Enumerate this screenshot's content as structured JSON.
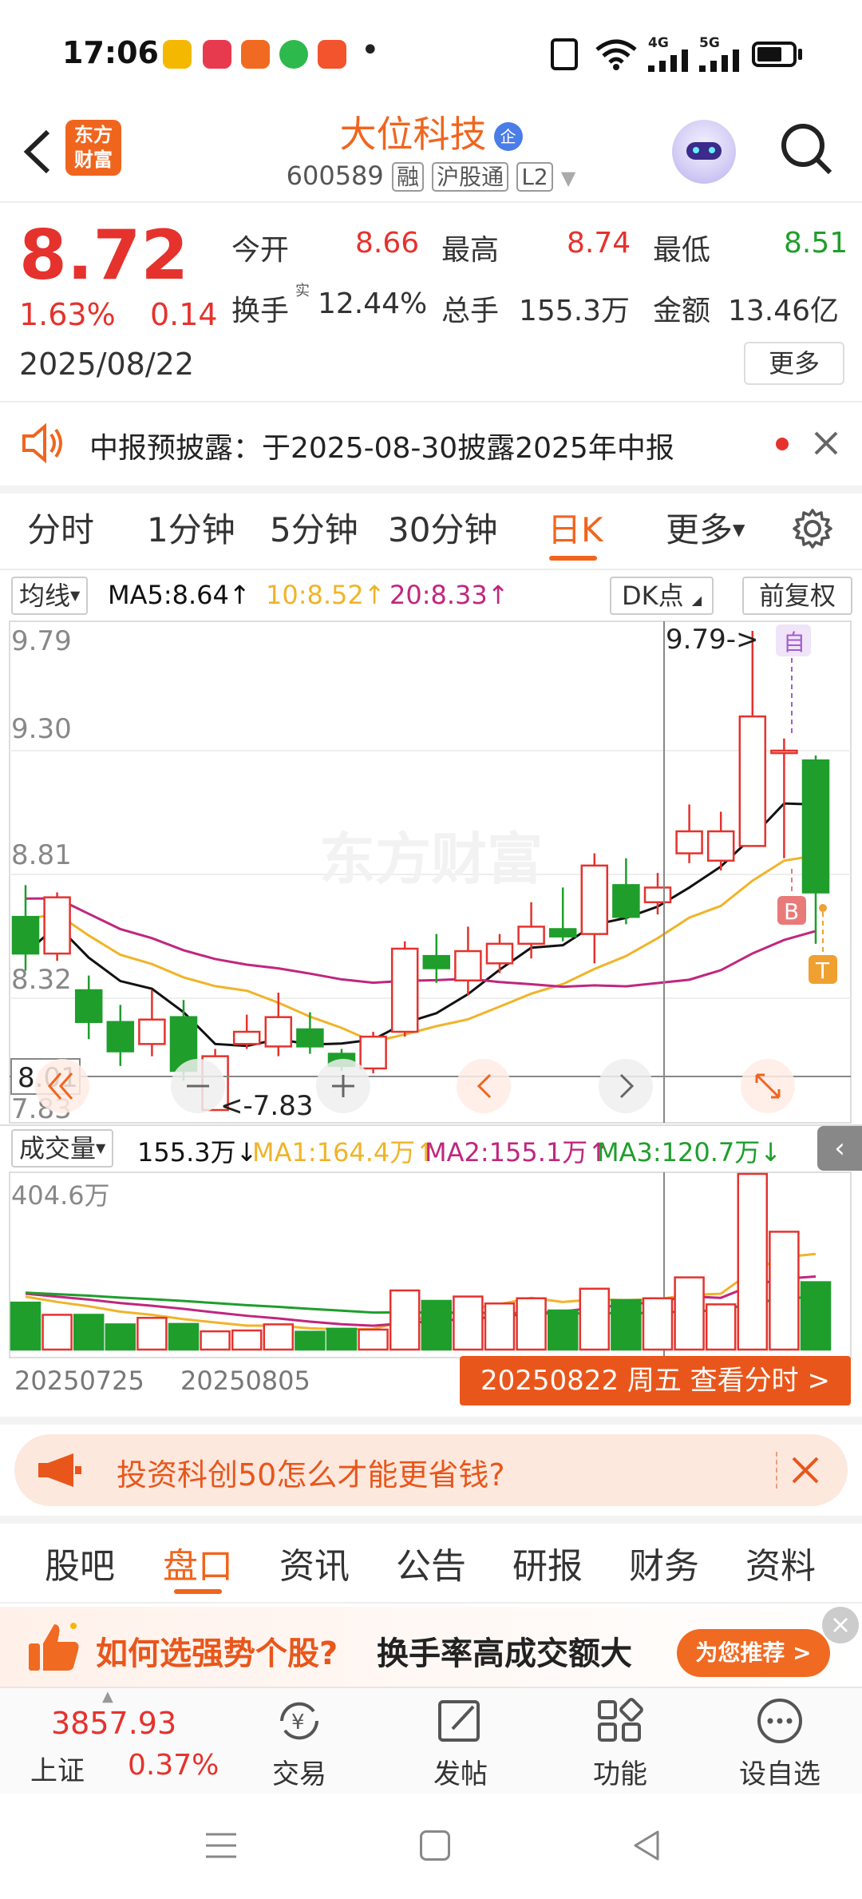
{
  "status_bar": {
    "time": "17:06",
    "app_icons": [
      "app1",
      "xiaohongshu",
      "app3",
      "app4",
      "app5"
    ],
    "notif_dot": "•",
    "signal_4g": "4G",
    "signal_5g": "5G"
  },
  "header": {
    "title": "大位科技",
    "title_badge": "企",
    "code": "600589",
    "tag_rong": "融",
    "tag_hgt": "沪股通",
    "tag_l2": "L2",
    "logo_text_1": "东方",
    "logo_text_2": "财富"
  },
  "quote": {
    "price": "8.72",
    "change_pct": "1.63%",
    "change": "0.14",
    "date": "2025/08/22",
    "open_label": "今开",
    "open": "8.66",
    "high_label": "最高",
    "high": "8.74",
    "low_label": "最低",
    "low": "8.51",
    "turnover_label": "换手",
    "turnover_sup": "实",
    "turnover": "12.44%",
    "volume_label": "总手",
    "volume": "155.3万",
    "amount_label": "金额",
    "amount": "13.46亿",
    "more_label": "更多"
  },
  "notice": {
    "text": "中报预披露：于2025-08-30披露2025年中报"
  },
  "chart_tabs": {
    "items": [
      "分时",
      "1分钟",
      "5分钟",
      "30分钟",
      "日K",
      "更多"
    ],
    "active": "日K"
  },
  "ma_bar": {
    "dropdown": "均线",
    "ma5": "MA5:8.64↑",
    "ma10": "10:8.52↑",
    "ma20": "20:8.33↑",
    "dk_label": "DK点",
    "adjust_label": "前复权"
  },
  "kchart": {
    "y_labels": [
      "9.79",
      "9.30",
      "8.81",
      "8.32",
      "7.83"
    ],
    "crosshair_price": "8.01",
    "high_marker": "9.79->",
    "low_marker": "<-7.83",
    "watermark": "东方财富",
    "marker_zi": "自",
    "marker_b": "B",
    "marker_t": "T"
  },
  "volume_bar": {
    "dropdown": "成交量",
    "vol": "155.3万↓",
    "ma1": "MA1:164.4万↑",
    "ma2": "MA2:155.1万↑",
    "ma3": "MA3:120.7万↓",
    "max_label": "404.6万"
  },
  "x_axis": {
    "d1": "20250725",
    "d2": "20250805",
    "view_time_label": "20250822 周五 查看分时 >"
  },
  "ad_banner": {
    "text": "投资科创50怎么才能更省钱?"
  },
  "bottom_tabs": {
    "items": [
      "股吧",
      "盘口",
      "资讯",
      "公告",
      "研报",
      "财务",
      "资料"
    ],
    "active": "盘口"
  },
  "promo": {
    "text1": "如何选强势个股?",
    "text2": "换手率高成交额大",
    "button": "为您推荐 >"
  },
  "bottom_nav": {
    "index_value": "3857.93",
    "index_name": "上证",
    "index_change": "0.37%",
    "trade": "交易",
    "post": "发帖",
    "func": "功能",
    "watch": "设自选"
  },
  "colors": {
    "up": "#e5322d",
    "down": "#1f9e2c",
    "accent": "#f0651e",
    "ma5": "#111111",
    "ma10": "#f0b429",
    "ma20": "#c0267e"
  },
  "chart_data": {
    "type": "candlestick",
    "ylim": [
      7.83,
      9.79
    ],
    "candles": [
      {
        "o": 8.62,
        "c": 8.47,
        "h": 8.75,
        "l": 8.4
      },
      {
        "o": 8.47,
        "c": 8.7,
        "h": 8.72,
        "l": 8.44
      },
      {
        "o": 8.32,
        "c": 8.19,
        "h": 8.38,
        "l": 8.12
      },
      {
        "o": 8.19,
        "c": 8.07,
        "h": 8.26,
        "l": 8.01
      },
      {
        "o": 8.1,
        "c": 8.2,
        "h": 8.32,
        "l": 8.05
      },
      {
        "o": 8.21,
        "c": 7.99,
        "h": 8.28,
        "l": 7.95
      },
      {
        "o": 7.83,
        "c": 8.05,
        "h": 8.08,
        "l": 7.83
      },
      {
        "o": 8.1,
        "c": 8.15,
        "h": 8.22,
        "l": 8.08
      },
      {
        "o": 8.09,
        "c": 8.21,
        "h": 8.31,
        "l": 8.05
      },
      {
        "o": 8.16,
        "c": 8.09,
        "h": 8.23,
        "l": 8.06
      },
      {
        "o": 8.06,
        "c": 8.01,
        "h": 8.08,
        "l": 7.99
      },
      {
        "o": 8.0,
        "c": 8.13,
        "h": 8.15,
        "l": 7.98
      },
      {
        "o": 8.15,
        "c": 8.49,
        "h": 8.52,
        "l": 8.13
      },
      {
        "o": 8.46,
        "c": 8.41,
        "h": 8.55,
        "l": 8.35
      },
      {
        "o": 8.36,
        "c": 8.48,
        "h": 8.58,
        "l": 8.3
      },
      {
        "o": 8.43,
        "c": 8.51,
        "h": 8.55,
        "l": 8.39
      },
      {
        "o": 8.51,
        "c": 8.58,
        "h": 8.68,
        "l": 8.45
      },
      {
        "o": 8.57,
        "c": 8.54,
        "h": 8.74,
        "l": 8.52
      },
      {
        "o": 8.55,
        "c": 8.83,
        "h": 8.88,
        "l": 8.43
      },
      {
        "o": 8.75,
        "c": 8.62,
        "h": 8.86,
        "l": 8.59
      },
      {
        "o": 8.68,
        "c": 8.74,
        "h": 8.8,
        "l": 8.63
      },
      {
        "o": 8.88,
        "c": 8.97,
        "h": 9.08,
        "l": 8.84
      },
      {
        "o": 8.85,
        "c": 8.97,
        "h": 9.05,
        "l": 8.81
      },
      {
        "o": 8.91,
        "c": 9.44,
        "h": 9.79,
        "l": 8.91
      },
      {
        "o": 9.29,
        "c": 9.3,
        "h": 9.35,
        "l": 8.86
      },
      {
        "o": 9.26,
        "c": 8.72,
        "h": 9.28,
        "l": 8.51
      }
    ],
    "volume_max": "404.6万",
    "volumes": [
      108,
      80,
      80,
      58,
      73,
      59,
      42,
      44,
      58,
      41,
      48,
      46,
      136,
      112,
      122,
      106,
      118,
      90,
      140,
      114,
      118,
      166,
      104,
      404,
      271,
      155
    ]
  }
}
